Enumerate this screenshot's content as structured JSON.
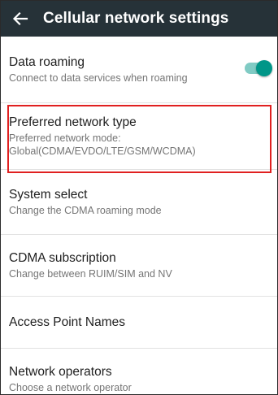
{
  "header": {
    "back_icon": "arrow-back-icon",
    "title": "Cellular network settings",
    "background": "#263238"
  },
  "items": [
    {
      "title": "Data roaming",
      "subtitle": "Connect to data services when roaming",
      "toggle": {
        "on": true,
        "accent": "#009688"
      }
    },
    {
      "title": "Preferred network type",
      "subtitle": "Preferred network mode: Global(CDMA/EVDO/LTE/GSM/WCDMA)",
      "highlighted": true,
      "highlight_color": "#e02020"
    },
    {
      "title": "System select",
      "subtitle": "Change the CDMA roaming mode"
    },
    {
      "title": "CDMA subscription",
      "subtitle": "Change between RUIM/SIM and NV"
    },
    {
      "title": "Access Point Names"
    },
    {
      "title": "Network operators",
      "subtitle": "Choose a network operator"
    }
  ]
}
